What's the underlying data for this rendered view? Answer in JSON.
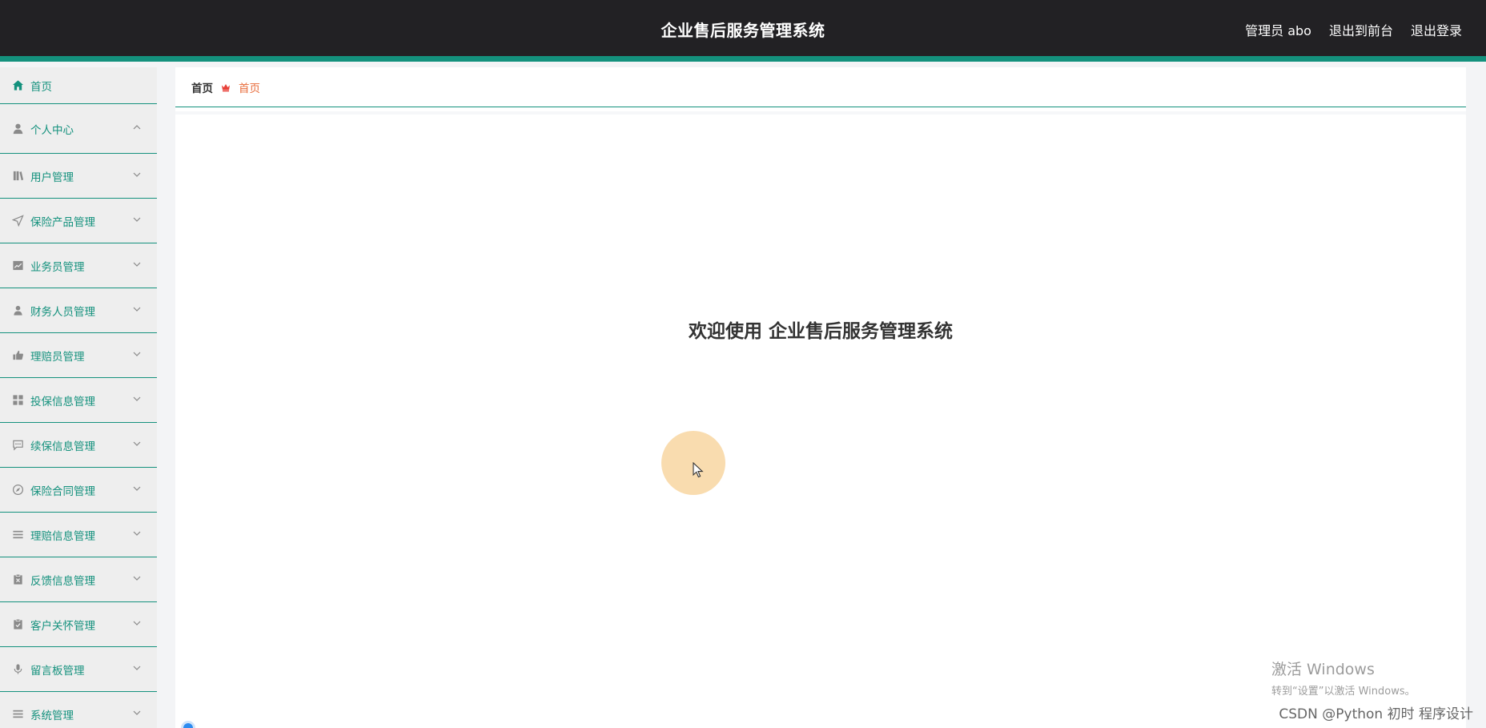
{
  "header": {
    "title": "企业售后服务管理系统",
    "admin_label": "管理员 abo",
    "front_label": "退出到前台",
    "logout_label": "退出登录"
  },
  "colors": {
    "header_bg": "#222124",
    "accent": "#14917d",
    "sidebar_bg": "#eeeeee",
    "breadcrumb_current": "#e86b3a"
  },
  "sidebar": {
    "items": [
      {
        "label": "首页",
        "icon": "home-icon"
      },
      {
        "label": "个人中心",
        "icon": "user-icon"
      },
      {
        "label": "用户管理",
        "icon": "book-icon"
      },
      {
        "label": "保险产品管理",
        "icon": "paper-plane-icon"
      },
      {
        "label": "业务员管理",
        "icon": "chart-icon"
      },
      {
        "label": "财务人员管理",
        "icon": "person-icon"
      },
      {
        "label": "理赔员管理",
        "icon": "thumbs-up-icon"
      },
      {
        "label": "投保信息管理",
        "icon": "grid-icon"
      },
      {
        "label": "续保信息管理",
        "icon": "chat-icon"
      },
      {
        "label": "保险合同管理",
        "icon": "compass-icon"
      },
      {
        "label": "理赔信息管理",
        "icon": "list-icon"
      },
      {
        "label": "反馈信息管理",
        "icon": "clipboard-x-icon"
      },
      {
        "label": "客户关怀管理",
        "icon": "clipboard-check-icon"
      },
      {
        "label": "留言板管理",
        "icon": "microphone-icon"
      },
      {
        "label": "系统管理",
        "icon": "menu-icon"
      }
    ]
  },
  "breadcrumb": {
    "root": "首页",
    "current": "首页",
    "separator_icon": "crown-icon"
  },
  "main": {
    "welcome": "欢迎使用 企业售后服务管理系统"
  },
  "overlay": {
    "windows_title": "激活 Windows",
    "windows_sub": "转到“设置”以激活 Windows。",
    "csdn": "CSDN @Python 初时 程序设计"
  }
}
